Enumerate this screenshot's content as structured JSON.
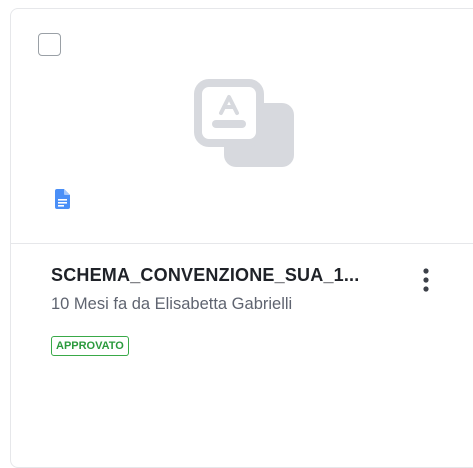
{
  "card": {
    "title": "SCHEMA_CONVENZIONE_SUA_1...",
    "subtitle": "10 Mesi fa da Elisabetta Gabrielli",
    "status": "APPROVATO"
  },
  "icons": {
    "placeholder": "image-placeholder-icon",
    "file_type": "document-icon",
    "menu": "more-vertical-icon"
  },
  "colors": {
    "status_green": "#39a948",
    "doc_blue": "#4a8ff7",
    "placeholder_gray": "#d7d9de"
  }
}
